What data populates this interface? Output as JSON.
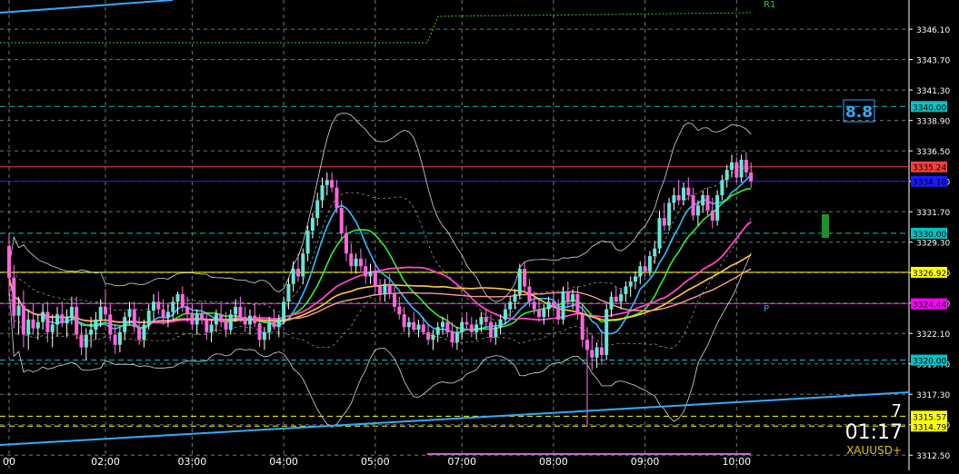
{
  "colors": {
    "background": "#000000",
    "grid": "#6a7d6a",
    "bull": "#ffffff",
    "bear": "#ff77ee",
    "bull_body": "#66e6d6",
    "bear_body": "#ff66dd"
  },
  "hud": {
    "bar_count": "7",
    "countdown": "01:17",
    "symbol": "XAUUSD+"
  },
  "chart_data": {
    "type": "candlestick",
    "symbol": "XAUUSD+",
    "ylim": [
      3311.3,
      3348.4
    ],
    "y_ticks": [
      "3346.10",
      "3343.70",
      "3341.30",
      "3338.90",
      "3336.50",
      "3334.10",
      "3331.70",
      "3329.30",
      "3326.90",
      "3324.50",
      "3322.10",
      "3319.70",
      "3317.30",
      "3314.90",
      "3312.50"
    ],
    "x_ticks": [
      {
        "label": "00",
        "bar": 0
      },
      {
        "label": "02:00",
        "bar": 20
      },
      {
        "label": "03:00",
        "bar": 38
      },
      {
        "label": "04:00",
        "bar": 57
      },
      {
        "label": "05:00",
        "bar": 76
      },
      {
        "label": "07:00",
        "bar": 94
      },
      {
        "label": "08:00",
        "bar": 113
      },
      {
        "label": "09:00",
        "bar": 132
      },
      {
        "label": "10:00",
        "bar": 151
      }
    ],
    "candles": [
      [
        3329.0,
        3330.0,
        3325.0,
        3326.5
      ],
      [
        3326.5,
        3327.5,
        3322.5,
        3323.5
      ],
      [
        3323.5,
        3325.0,
        3322.0,
        3324.3
      ],
      [
        3324.3,
        3325.5,
        3321.0,
        3322.0
      ],
      [
        3322.0,
        3324.0,
        3320.8,
        3323.2
      ],
      [
        3323.2,
        3324.5,
        3322.0,
        3322.5
      ],
      [
        3322.5,
        3323.6,
        3321.6,
        3323.0
      ],
      [
        3323.0,
        3324.4,
        3322.4,
        3323.8
      ],
      [
        3323.8,
        3324.6,
        3321.4,
        3322.2
      ],
      [
        3322.2,
        3323.6,
        3321.0,
        3322.8
      ],
      [
        3322.8,
        3324.2,
        3321.9,
        3323.6
      ],
      [
        3323.6,
        3324.6,
        3322.6,
        3322.9
      ],
      [
        3322.9,
        3324.0,
        3321.8,
        3323.4
      ],
      [
        3323.4,
        3325.0,
        3322.8,
        3324.2
      ],
      [
        3324.2,
        3325.0,
        3321.6,
        3322.0
      ],
      [
        3322.0,
        3323.0,
        3320.4,
        3321.0
      ],
      [
        3321.0,
        3322.5,
        3320.0,
        3322.0
      ],
      [
        3322.0,
        3323.4,
        3321.0,
        3322.4
      ],
      [
        3322.4,
        3323.8,
        3321.6,
        3323.2
      ],
      [
        3323.2,
        3324.8,
        3322.6,
        3324.2
      ],
      [
        3324.2,
        3325.6,
        3323.0,
        3323.6
      ],
      [
        3323.6,
        3324.4,
        3321.5,
        3322.0
      ],
      [
        3322.0,
        3322.8,
        3320.5,
        3321.2
      ],
      [
        3321.2,
        3322.6,
        3320.6,
        3322.2
      ],
      [
        3322.2,
        3323.8,
        3321.6,
        3323.4
      ],
      [
        3323.4,
        3324.6,
        3322.8,
        3324.0
      ],
      [
        3324.0,
        3324.6,
        3322.2,
        3322.6
      ],
      [
        3322.6,
        3323.4,
        3321.2,
        3321.6
      ],
      [
        3321.6,
        3323.2,
        3321.0,
        3322.8
      ],
      [
        3322.8,
        3324.4,
        3322.4,
        3323.9
      ],
      [
        3323.9,
        3325.2,
        3323.2,
        3324.6
      ],
      [
        3324.6,
        3325.4,
        3323.6,
        3324.0
      ],
      [
        3324.0,
        3324.8,
        3322.8,
        3323.4
      ],
      [
        3323.4,
        3324.4,
        3322.6,
        3323.8
      ],
      [
        3323.8,
        3325.0,
        3323.2,
        3324.6
      ],
      [
        3324.6,
        3325.4,
        3323.6,
        3325.2
      ],
      [
        3325.2,
        3325.8,
        3323.8,
        3324.2
      ],
      [
        3324.2,
        3325.0,
        3323.0,
        3323.6
      ],
      [
        3323.6,
        3324.4,
        3322.4,
        3322.8
      ],
      [
        3322.8,
        3324.0,
        3322.0,
        3323.6
      ],
      [
        3323.6,
        3324.6,
        3322.8,
        3323.2
      ],
      [
        3323.2,
        3323.8,
        3321.6,
        3322.2
      ],
      [
        3322.2,
        3323.2,
        3321.4,
        3322.8
      ],
      [
        3322.8,
        3324.0,
        3322.2,
        3323.6
      ],
      [
        3323.6,
        3324.4,
        3322.6,
        3323.0
      ],
      [
        3323.0,
        3323.8,
        3321.8,
        3322.4
      ],
      [
        3322.4,
        3324.0,
        3322.0,
        3323.6
      ],
      [
        3323.6,
        3324.8,
        3323.0,
        3324.2
      ],
      [
        3324.2,
        3325.0,
        3323.0,
        3323.4
      ],
      [
        3323.4,
        3324.2,
        3322.2,
        3322.8
      ],
      [
        3322.8,
        3324.0,
        3322.0,
        3323.5
      ],
      [
        3323.5,
        3324.5,
        3322.6,
        3322.9
      ],
      [
        3322.9,
        3323.6,
        3321.0,
        3321.6
      ],
      [
        3321.6,
        3322.6,
        3320.8,
        3322.2
      ],
      [
        3322.2,
        3323.4,
        3321.6,
        3323.0
      ],
      [
        3323.0,
        3324.0,
        3322.4,
        3322.6
      ],
      [
        3322.6,
        3323.6,
        3321.8,
        3323.2
      ],
      [
        3323.2,
        3325.0,
        3322.8,
        3324.6
      ],
      [
        3324.6,
        3326.5,
        3324.0,
        3326.0
      ],
      [
        3326.0,
        3327.8,
        3325.4,
        3327.2
      ],
      [
        3327.2,
        3328.4,
        3326.2,
        3326.6
      ],
      [
        3326.6,
        3328.8,
        3326.0,
        3328.4
      ],
      [
        3328.4,
        3330.6,
        3327.8,
        3330.2
      ],
      [
        3330.2,
        3331.6,
        3329.6,
        3331.2
      ],
      [
        3331.2,
        3333.2,
        3330.6,
        3332.6
      ],
      [
        3332.6,
        3334.4,
        3332.0,
        3333.8
      ],
      [
        3333.8,
        3334.8,
        3333.0,
        3334.2
      ],
      [
        3334.2,
        3334.8,
        3333.2,
        3333.6
      ],
      [
        3333.6,
        3334.2,
        3331.6,
        3332.0
      ],
      [
        3332.0,
        3332.6,
        3329.4,
        3330.0
      ],
      [
        3330.0,
        3330.6,
        3327.8,
        3328.4
      ],
      [
        3328.4,
        3329.2,
        3326.8,
        3327.4
      ],
      [
        3327.4,
        3328.4,
        3326.8,
        3328.0
      ],
      [
        3328.0,
        3328.8,
        3327.0,
        3327.4
      ],
      [
        3327.4,
        3328.0,
        3326.0,
        3326.6
      ],
      [
        3326.6,
        3327.6,
        3326.0,
        3327.0
      ],
      [
        3327.0,
        3327.6,
        3325.4,
        3325.8
      ],
      [
        3325.8,
        3326.4,
        3324.6,
        3325.2
      ],
      [
        3325.2,
        3326.4,
        3324.6,
        3326.0
      ],
      [
        3326.0,
        3326.8,
        3324.8,
        3325.2
      ],
      [
        3325.2,
        3325.8,
        3323.8,
        3324.2
      ],
      [
        3324.2,
        3325.0,
        3323.2,
        3323.6
      ],
      [
        3323.6,
        3324.2,
        3322.2,
        3322.6
      ],
      [
        3322.6,
        3323.4,
        3321.8,
        3323.0
      ],
      [
        3323.0,
        3323.8,
        3322.2,
        3322.4
      ],
      [
        3322.4,
        3323.2,
        3321.8,
        3322.8
      ],
      [
        3322.8,
        3323.4,
        3322.0,
        3322.2
      ],
      [
        3322.2,
        3322.8,
        3321.2,
        3321.6
      ],
      [
        3321.6,
        3322.4,
        3320.8,
        3322.0
      ],
      [
        3322.0,
        3323.0,
        3321.4,
        3322.6
      ],
      [
        3322.6,
        3323.4,
        3322.0,
        3323.0
      ],
      [
        3323.0,
        3323.6,
        3321.8,
        3322.2
      ],
      [
        3322.2,
        3323.0,
        3321.0,
        3321.4
      ],
      [
        3321.4,
        3322.6,
        3320.8,
        3322.2
      ],
      [
        3322.2,
        3323.4,
        3321.6,
        3323.0
      ],
      [
        3323.0,
        3323.8,
        3322.4,
        3322.8
      ],
      [
        3322.8,
        3323.4,
        3321.8,
        3322.2
      ],
      [
        3322.2,
        3323.2,
        3321.6,
        3322.8
      ],
      [
        3322.8,
        3323.8,
        3322.2,
        3323.4
      ],
      [
        3323.4,
        3324.0,
        3322.6,
        3323.0
      ],
      [
        3323.0,
        3323.6,
        3321.4,
        3321.8
      ],
      [
        3321.8,
        3323.0,
        3321.2,
        3322.6
      ],
      [
        3322.6,
        3323.6,
        3322.0,
        3323.2
      ],
      [
        3323.2,
        3324.4,
        3322.8,
        3324.0
      ],
      [
        3324.0,
        3325.0,
        3323.4,
        3324.6
      ],
      [
        3324.6,
        3325.6,
        3324.0,
        3325.2
      ],
      [
        3325.2,
        3327.6,
        3324.8,
        3327.2
      ],
      [
        3327.2,
        3327.8,
        3325.4,
        3325.8
      ],
      [
        3325.8,
        3326.4,
        3324.2,
        3324.6
      ],
      [
        3324.6,
        3325.4,
        3323.6,
        3324.0
      ],
      [
        3324.0,
        3324.8,
        3323.0,
        3323.4
      ],
      [
        3323.4,
        3324.4,
        3322.8,
        3324.0
      ],
      [
        3324.0,
        3325.0,
        3323.4,
        3324.6
      ],
      [
        3324.6,
        3325.4,
        3323.8,
        3324.2
      ],
      [
        3324.2,
        3324.8,
        3322.8,
        3323.2
      ],
      [
        3323.2,
        3325.8,
        3322.8,
        3325.4
      ],
      [
        3325.4,
        3326.2,
        3324.2,
        3324.6
      ],
      [
        3324.6,
        3325.6,
        3324.0,
        3325.2
      ],
      [
        3325.2,
        3325.8,
        3323.2,
        3323.6
      ],
      [
        3323.6,
        3324.4,
        3321.0,
        3321.6
      ],
      [
        3321.6,
        3322.6,
        3314.8,
        3320.8
      ],
      [
        3320.8,
        3322.0,
        3319.2,
        3320.2
      ],
      [
        3320.2,
        3321.4,
        3319.4,
        3321.0
      ],
      [
        3321.0,
        3322.4,
        3319.6,
        3320.4
      ],
      [
        3320.4,
        3324.4,
        3320.0,
        3324.0
      ],
      [
        3324.0,
        3325.4,
        3323.4,
        3325.0
      ],
      [
        3325.0,
        3325.8,
        3324.4,
        3324.6
      ],
      [
        3324.6,
        3325.6,
        3324.0,
        3325.2
      ],
      [
        3325.2,
        3326.2,
        3324.6,
        3325.8
      ],
      [
        3325.8,
        3326.6,
        3325.0,
        3326.2
      ],
      [
        3326.2,
        3327.0,
        3325.6,
        3326.6
      ],
      [
        3326.6,
        3327.8,
        3326.0,
        3327.4
      ],
      [
        3327.4,
        3328.2,
        3326.6,
        3327.0
      ],
      [
        3327.0,
        3328.6,
        3326.6,
        3328.2
      ],
      [
        3328.2,
        3329.4,
        3327.6,
        3328.8
      ],
      [
        3328.8,
        3331.8,
        3328.4,
        3331.2
      ],
      [
        3331.2,
        3332.4,
        3330.2,
        3330.6
      ],
      [
        3330.6,
        3332.8,
        3330.2,
        3332.4
      ],
      [
        3332.4,
        3333.6,
        3331.8,
        3333.0
      ],
      [
        3333.0,
        3334.2,
        3332.2,
        3332.6
      ],
      [
        3332.6,
        3334.0,
        3332.2,
        3333.6
      ],
      [
        3333.6,
        3334.4,
        3332.6,
        3333.0
      ],
      [
        3333.0,
        3333.6,
        3331.0,
        3331.4
      ],
      [
        3331.4,
        3332.6,
        3330.6,
        3332.2
      ],
      [
        3332.2,
        3333.4,
        3331.6,
        3333.0
      ],
      [
        3333.0,
        3333.6,
        3331.4,
        3331.8
      ],
      [
        3331.8,
        3332.8,
        3330.4,
        3331.0
      ],
      [
        3331.0,
        3333.4,
        3330.6,
        3333.0
      ],
      [
        3333.0,
        3334.6,
        3332.6,
        3334.2
      ],
      [
        3334.2,
        3335.4,
        3333.6,
        3335.0
      ],
      [
        3335.0,
        3336.2,
        3334.4,
        3335.6
      ],
      [
        3335.6,
        3336.0,
        3334.0,
        3334.4
      ],
      [
        3334.4,
        3336.2,
        3334.0,
        3335.8
      ],
      [
        3335.8,
        3336.4,
        3334.4,
        3334.8
      ],
      [
        3334.8,
        3335.6,
        3333.6,
        3334.1
      ]
    ],
    "price_labels": [
      {
        "price": 3340.0,
        "text": "3340.00",
        "color": "#00c4c4",
        "line": "dashed"
      },
      {
        "price": 3335.24,
        "text": "3335.24",
        "color": "#ff3b3b",
        "line": "solid"
      },
      {
        "price": 3334.1,
        "text": "3334.10",
        "color": "#1a1aff",
        "line": "solid"
      },
      {
        "price": 3330.0,
        "text": "3330.00",
        "color": "#00c4c4",
        "line": "dashed"
      },
      {
        "price": 3326.92,
        "text": "3326.92",
        "color": "#ffff00",
        "line": "solid"
      },
      {
        "price": 3324.44,
        "text": "3324.44",
        "color": "#ff00ff",
        "line": "solid"
      },
      {
        "price": 3320.0,
        "text": "3320.00",
        "color": "#00c4c4",
        "line": "dashed"
      },
      {
        "price": 3315.57,
        "text": "3315.57",
        "color": "#ffff00",
        "line": "dashed"
      },
      {
        "price": 3314.79,
        "text": "3314.79",
        "color": "#ffff00",
        "line": "dashed"
      }
    ],
    "annotations": [
      {
        "text": "R1",
        "price": 3348.2,
        "color": "#3ec43e"
      },
      {
        "text": "P",
        "price": 3324.2,
        "color": "#2ab0d6"
      },
      {
        "text": "8.8",
        "color": "#33aaff"
      }
    ]
  }
}
